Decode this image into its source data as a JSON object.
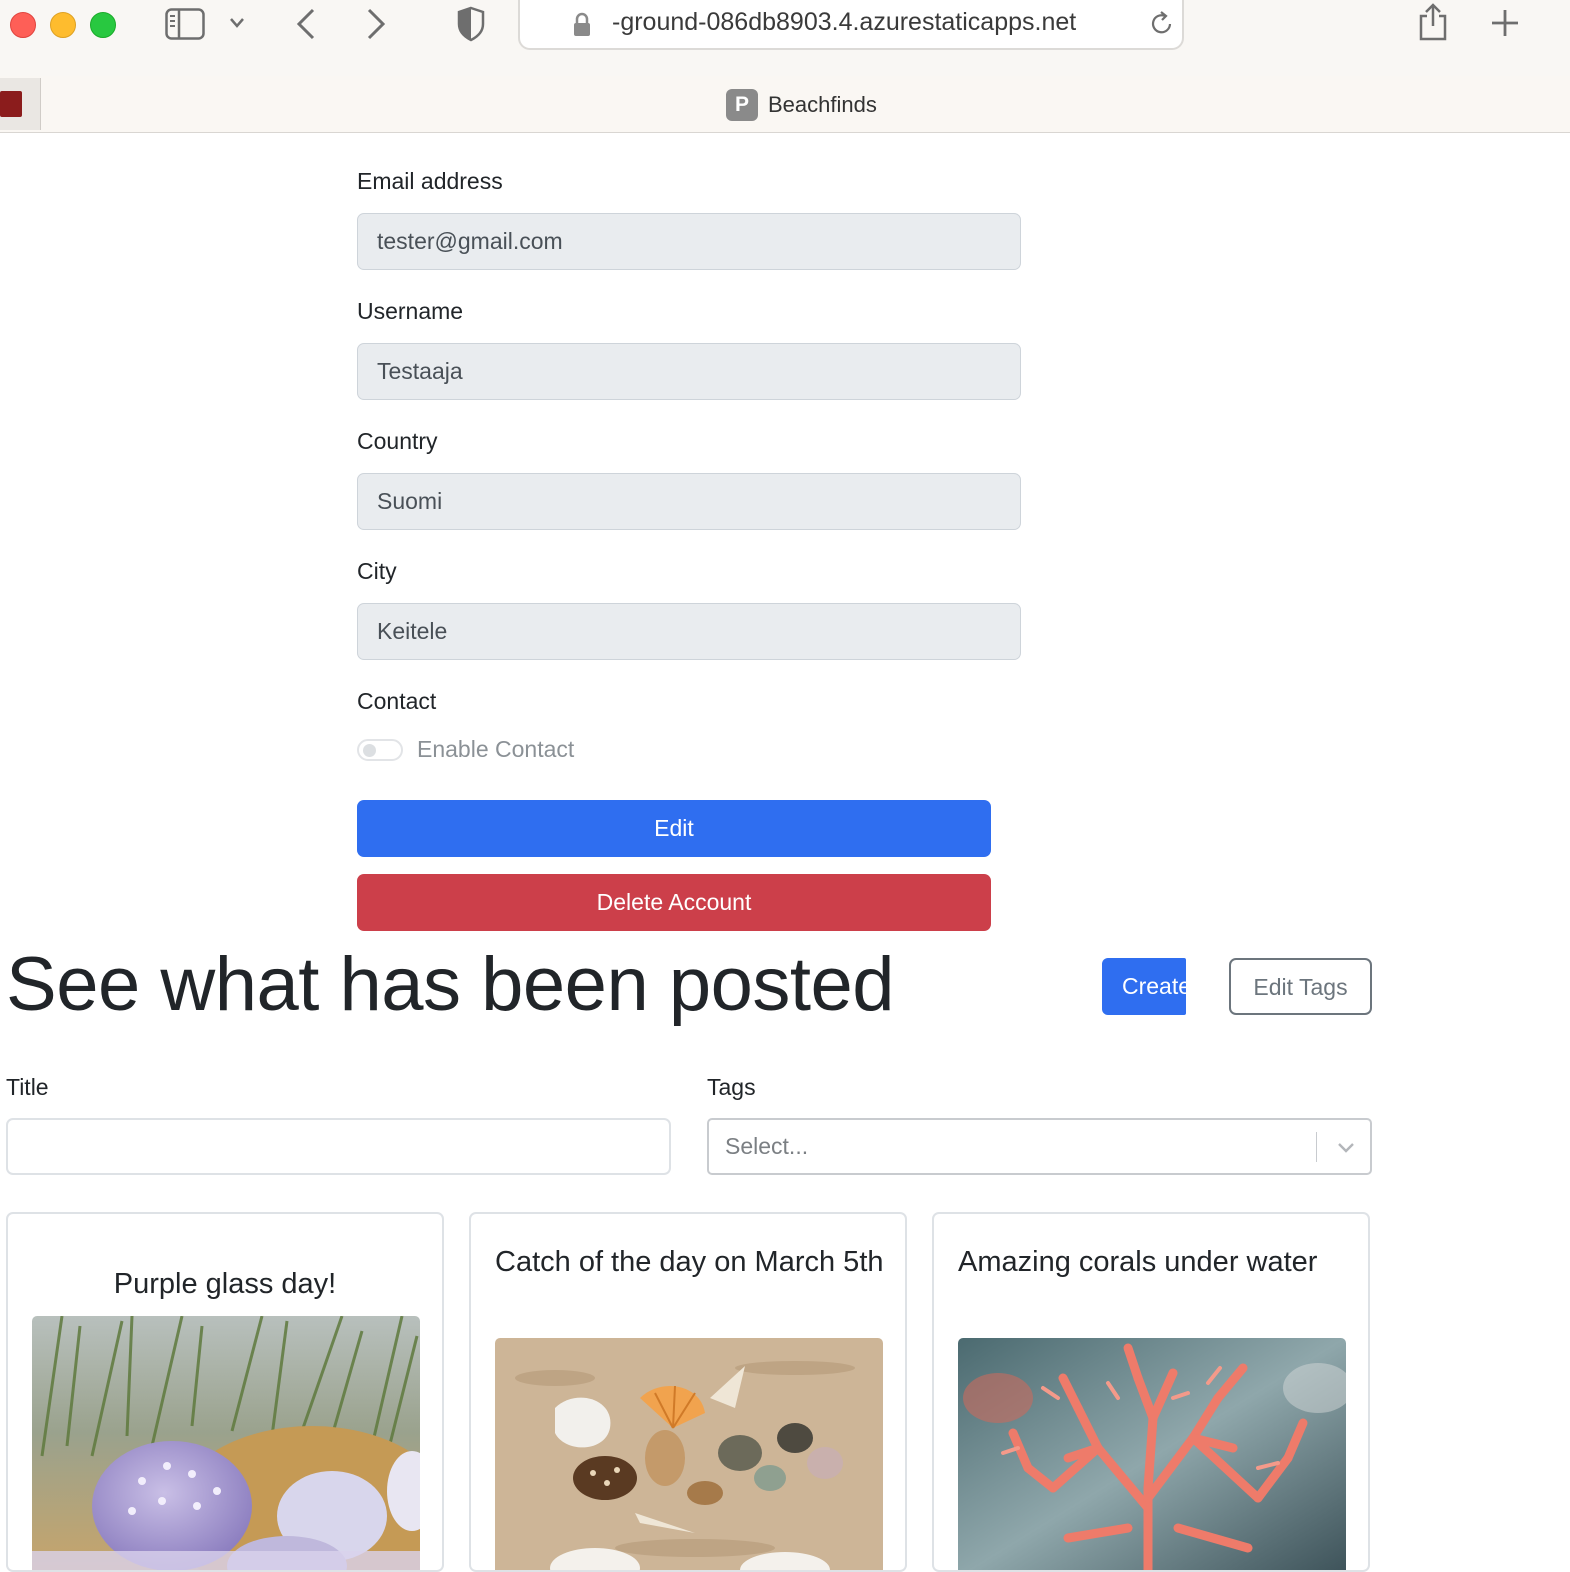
{
  "browser": {
    "url": "-ground-086db8903.4.azurestaticapps.net",
    "tab_badge": "P",
    "tab_title": "Beachfinds"
  },
  "profile": {
    "email_label": "Email address",
    "email_value": "tester@gmail.com",
    "username_label": "Username",
    "username_value": "Testaaja",
    "country_label": "Country",
    "country_value": "Suomi",
    "city_label": "City",
    "city_value": "Keitele",
    "contact_label": "Contact",
    "contact_switch_label": "Enable Contact",
    "contact_enabled": false,
    "edit_button": "Edit",
    "delete_button": "Delete Account"
  },
  "posts": {
    "heading": "See what has been posted",
    "create_button": "Create",
    "edit_tags_button": "Edit Tags",
    "filter_title_label": "Title",
    "filter_title_value": "",
    "filter_tags_label": "Tags",
    "filter_tags_placeholder": "Select...",
    "cards": [
      {
        "title": "Purple glass day!"
      },
      {
        "title": "Catch of the day on March 5th"
      },
      {
        "title": "Amazing corals under water"
      }
    ]
  },
  "colors": {
    "primary": "#2f6ef0",
    "danger": "#cc3f4a",
    "secondary": "#6c757d",
    "readonly_field_bg": "#e9ecef"
  }
}
